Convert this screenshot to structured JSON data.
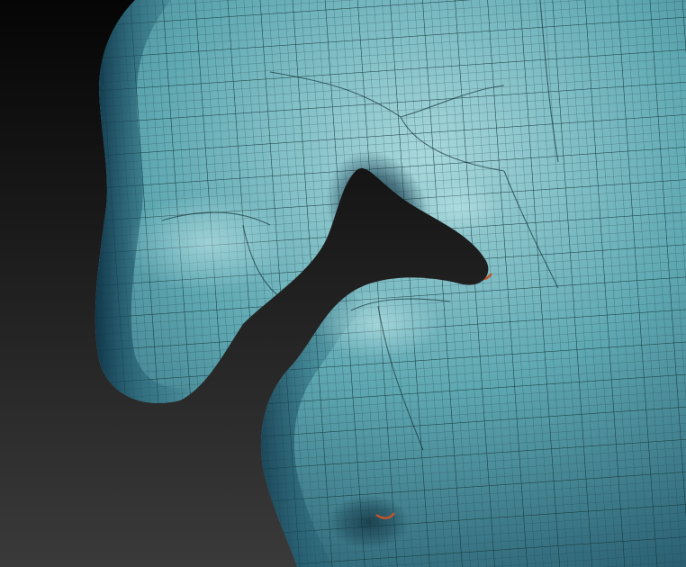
{
  "viewport": {
    "background_top": "#050505",
    "background_bottom": "#3a3a3a",
    "mesh_base_color": "#5fa8b2",
    "mesh_highlight_color": "#a8d8dc",
    "mesh_shadow_color": "#1e4f63",
    "wire_color": "#163b40",
    "crease_accent_color": "#c0542e"
  }
}
